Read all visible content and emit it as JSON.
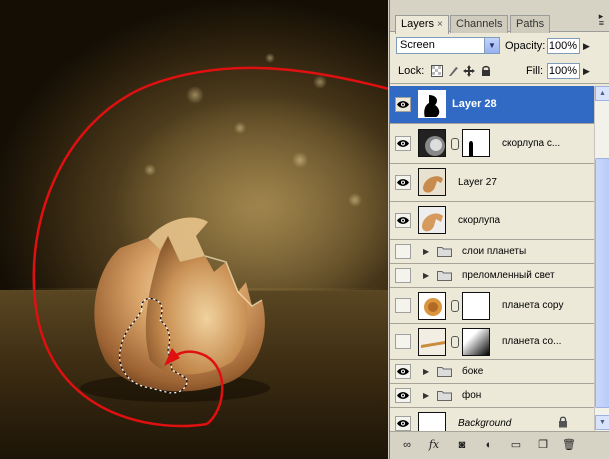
{
  "panel": {
    "tabs": [
      {
        "label": "Layers",
        "close": "×"
      },
      {
        "label": "Channels"
      },
      {
        "label": "Paths"
      }
    ],
    "blend_mode": "Screen",
    "opacity_label": "Opacity:",
    "opacity_value": "100%",
    "lock_label": "Lock:",
    "fill_label": "Fill:",
    "fill_value": "100%",
    "layers": [
      {
        "name": "Layer 28",
        "selected": true,
        "visible": true,
        "kind": "pixel"
      },
      {
        "name": "скорлупа с...",
        "visible": true,
        "kind": "masked"
      },
      {
        "name": "Layer 27",
        "visible": true,
        "kind": "pixel"
      },
      {
        "name": "скорлупа",
        "visible": true,
        "kind": "pixel"
      },
      {
        "name": "слои планеты",
        "visible": false,
        "kind": "group"
      },
      {
        "name": "преломленный свет",
        "visible": false,
        "kind": "group"
      },
      {
        "name": "планета copy",
        "visible": false,
        "kind": "masked"
      },
      {
        "name": "планета со...",
        "visible": false,
        "kind": "masked"
      },
      {
        "name": "боке",
        "visible": true,
        "kind": "group"
      },
      {
        "name": "фон",
        "visible": true,
        "kind": "group"
      },
      {
        "name": "Background",
        "visible": true,
        "kind": "background"
      }
    ]
  },
  "icons": {
    "eye": "eye-icon",
    "link": "link-icon",
    "folder": "folder-icon",
    "lock": "lock-icon",
    "menu": "panel-menu-icon"
  },
  "colors": {
    "selection": "#316ac5",
    "annotation": "#e01010"
  }
}
